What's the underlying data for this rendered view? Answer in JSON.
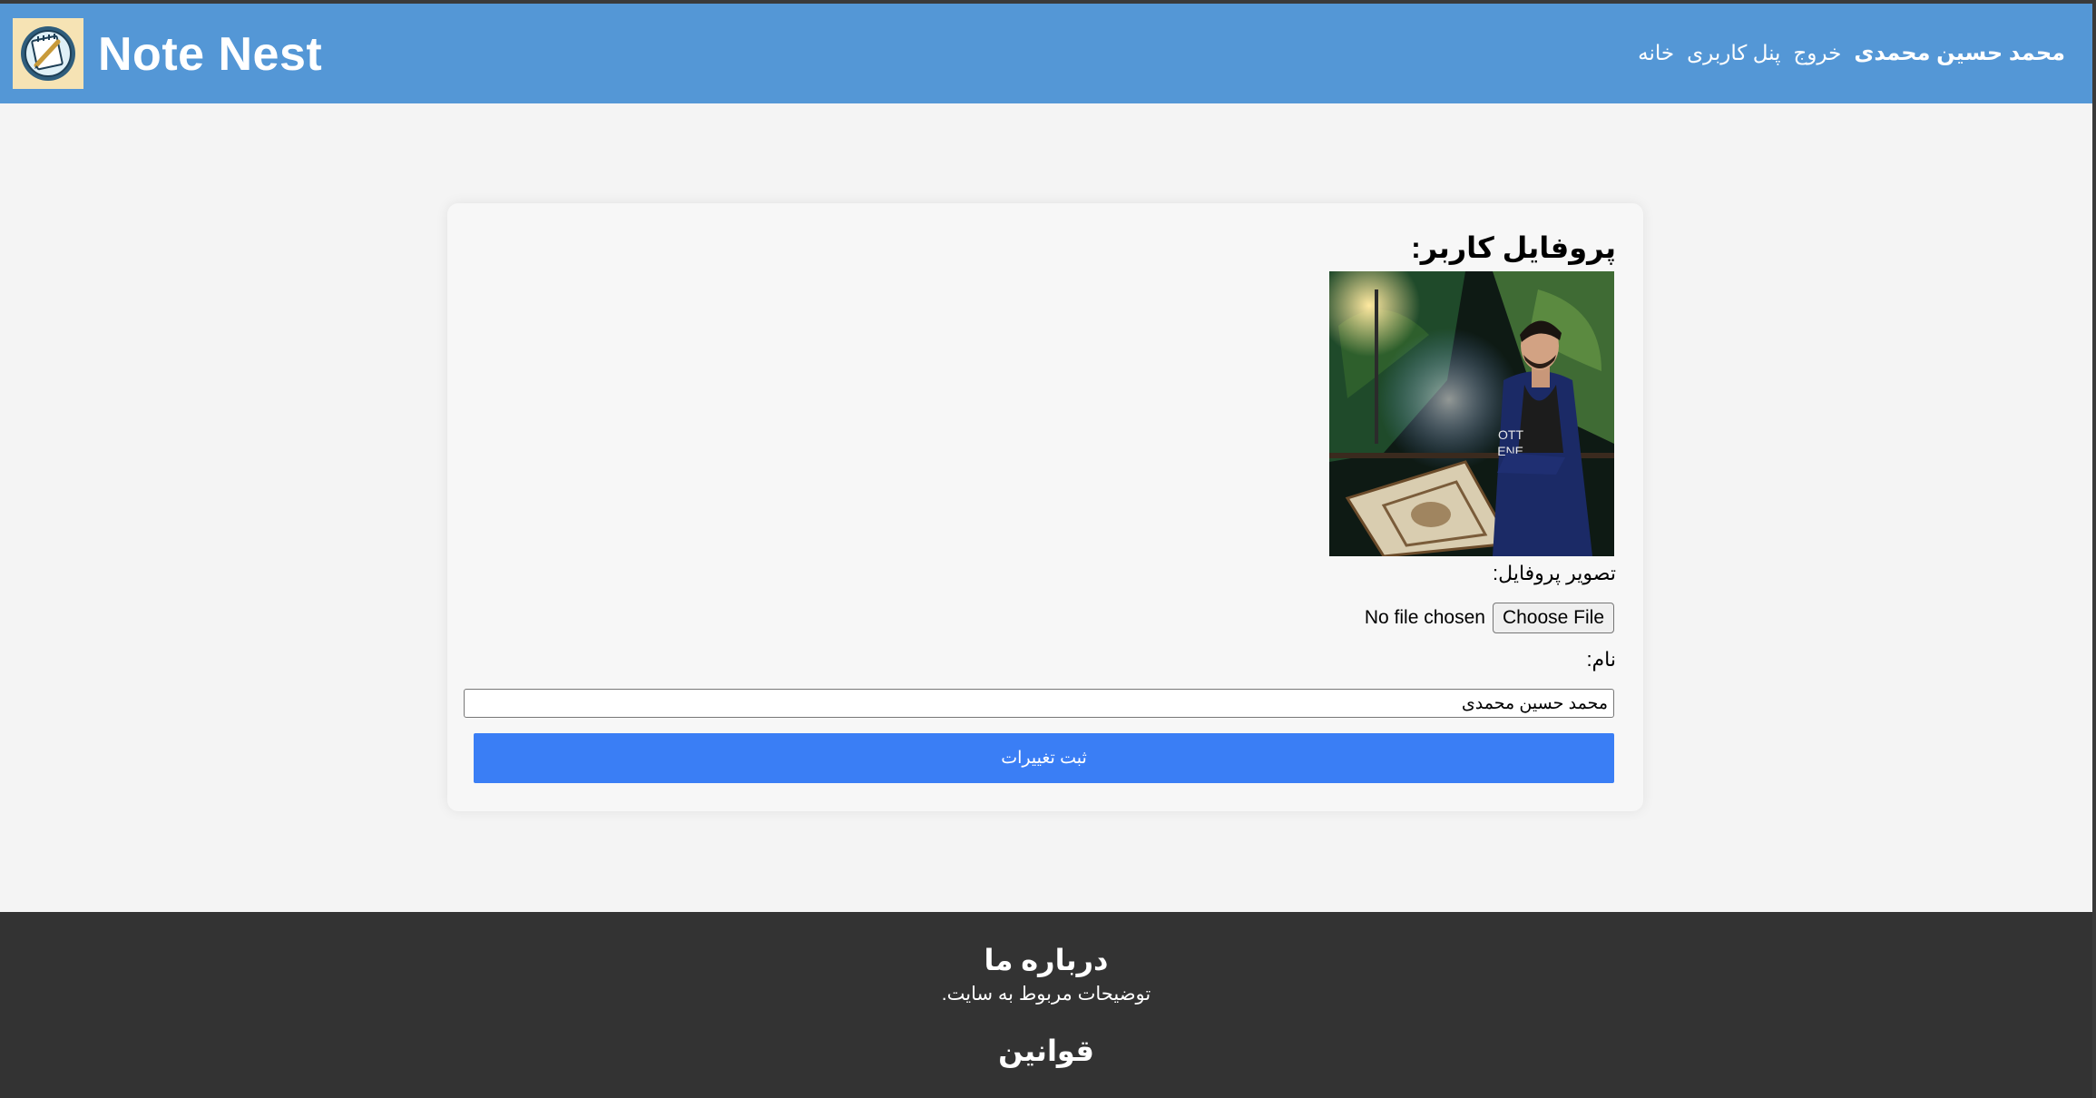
{
  "app": {
    "brand": "Note Nest",
    "logo_icon": "notepad-logo-icon"
  },
  "nav": {
    "home": "خانه",
    "panel": "پنل کاربری",
    "logout": "خروج",
    "user_name": "محمد حسین محمدی"
  },
  "profile": {
    "title": "پروفایل کاربر:",
    "photo_label": "تصویر پروفایل:",
    "choose_file": "Choose File",
    "file_status": "No file chosen",
    "name_label": "نام:",
    "name_value": "محمد حسین محمدی",
    "submit": "ثبت تغییرات"
  },
  "footer": {
    "about_title": "درباره ما",
    "about_desc": "توضیحات مربوط به سایت.",
    "rules_title": "قوانین"
  },
  "colors": {
    "header": "#5497d6",
    "button": "#3a7ef5",
    "footer": "#333333",
    "background": "#f4f4f4"
  }
}
